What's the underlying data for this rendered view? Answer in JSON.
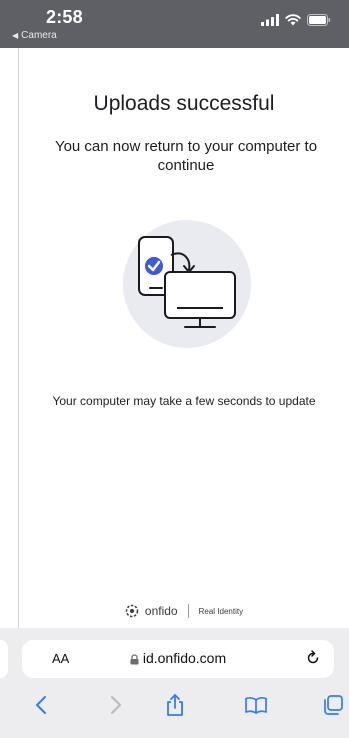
{
  "status_bar": {
    "time": "2:58",
    "back_app": "Camera"
  },
  "content": {
    "title": "Uploads successful",
    "subtitle": "You can now return to your computer to continue",
    "note": "Your computer may take a few seconds to update",
    "brand": {
      "name": "onfido",
      "tagline": "Real Identity"
    }
  },
  "browser": {
    "text_size_label": "AA",
    "url": "id.onfido.com"
  },
  "colors": {
    "status_bar_bg": "#5f6066",
    "accent_blue": "#3b5bdb",
    "illustration_bg": "#e9ebf0",
    "ios_blue": "#2f7ef6"
  }
}
